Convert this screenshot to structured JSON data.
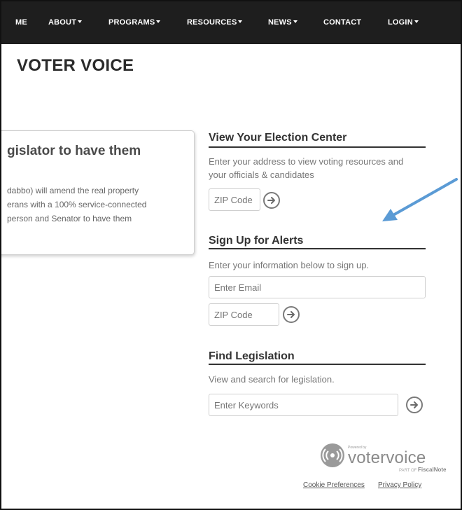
{
  "nav": {
    "items": [
      {
        "label": "ME",
        "caret": false
      },
      {
        "label": "ABOUT",
        "caret": true
      },
      {
        "label": "PROGRAMS",
        "caret": true
      },
      {
        "label": "RESOURCES",
        "caret": true
      },
      {
        "label": "NEWS",
        "caret": true
      },
      {
        "label": "CONTACT",
        "caret": false
      },
      {
        "label": "LOGIN",
        "caret": true
      }
    ]
  },
  "page_title": "VOTER VOICE",
  "card": {
    "heading": "gislator to have them",
    "body_lines": [
      "dabbo) will amend the real property",
      "erans with a 100% service-connected",
      "person and Senator to have them"
    ]
  },
  "election_center": {
    "heading": "View Your Election Center",
    "description_lines": [
      "Enter your address to view voting resources and",
      "your officials & candidates"
    ],
    "zip_placeholder": "ZIP Code"
  },
  "alerts": {
    "heading": "Sign Up for Alerts",
    "description": "Enter your information below to sign up.",
    "email_placeholder": "Enter Email",
    "zip_placeholder": "ZIP Code"
  },
  "legislation": {
    "heading": "Find Legislation",
    "description": "View and search for legislation.",
    "keywords_placeholder": "Enter Keywords"
  },
  "branding": {
    "powered_by": "Powered by",
    "wordmark": "votervoice",
    "part_of_prefix": "PART OF",
    "part_of_brand": "FiscalNote"
  },
  "footer": {
    "cookie_link": "Cookie Preferences",
    "privacy_link": "Privacy Policy"
  },
  "colors": {
    "nav_bg": "#1e1e1e",
    "annotation_arrow": "#5b9bd5"
  }
}
